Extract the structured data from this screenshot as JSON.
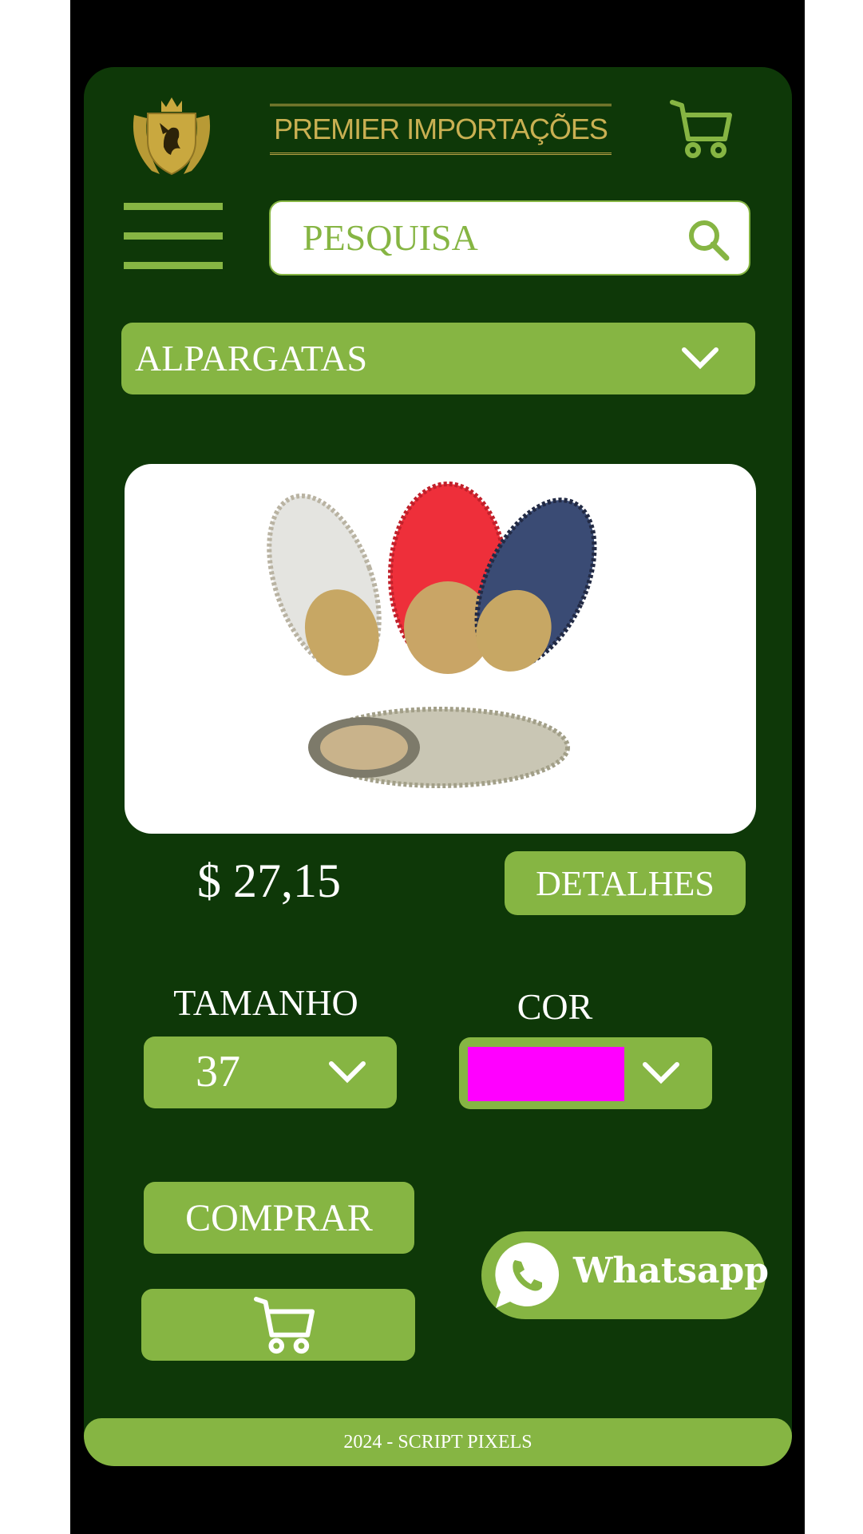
{
  "header": {
    "brand": "PREMIER IMPORTAÇÕES",
    "logo_icon": "crest-griffin-logo",
    "cart_icon": "cart-icon"
  },
  "search": {
    "placeholder": "PESQUISA",
    "icon": "search-icon"
  },
  "category": {
    "selected": "ALPARGATAS"
  },
  "product": {
    "image_alt": "alpargatas",
    "price": "$ 27,15",
    "details_label": "DETALHES",
    "size_label": "TAMANHO",
    "size_value": "37",
    "color_label": "COR",
    "color_value": "#ff00ff",
    "buy_label": "COMPRAR"
  },
  "whatsapp": {
    "label": "Whatsapp"
  },
  "footer": {
    "text": "2024 - SCRIPT PIXELS"
  },
  "colors": {
    "background": "#0e3808",
    "accent": "#86b543",
    "gold": "#c9b052"
  }
}
